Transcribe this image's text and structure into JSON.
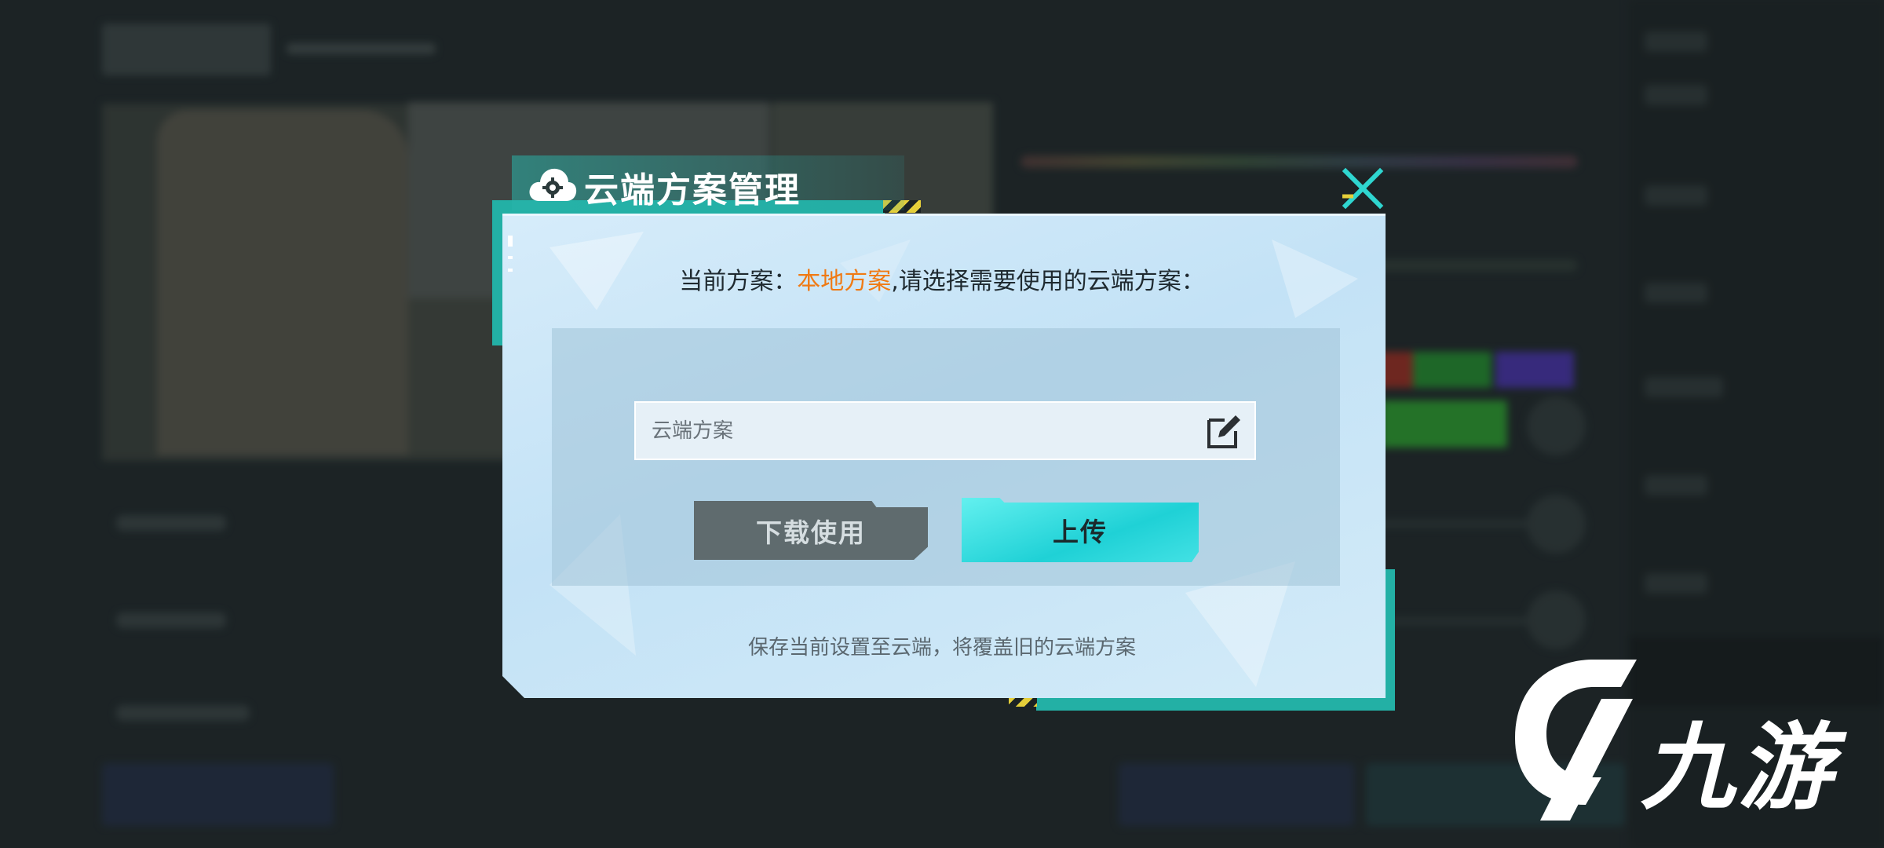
{
  "dialog": {
    "title": "云端方案管理",
    "prompt_prefix": "当前方案：",
    "current_plan": "本地方案",
    "prompt_suffix": ",请选择需要使用的云端方案：",
    "name_field_placeholder": "云端方案",
    "download_button": "下载使用",
    "upload_button": "上传",
    "hint": "保存当前设置至云端，将覆盖旧的云端方案"
  },
  "watermark": {
    "brand": "九游"
  },
  "colors": {
    "accent_teal": "#23b0a5",
    "highlight_orange": "#f07a14",
    "upload_cyan": "#1fd1d6",
    "download_gray": "#5f6b6e"
  },
  "icons": {
    "title": "cloud-gear-icon",
    "close": "close-icon",
    "edit": "edit-icon",
    "watermark": "jiuyou-logo-icon"
  }
}
